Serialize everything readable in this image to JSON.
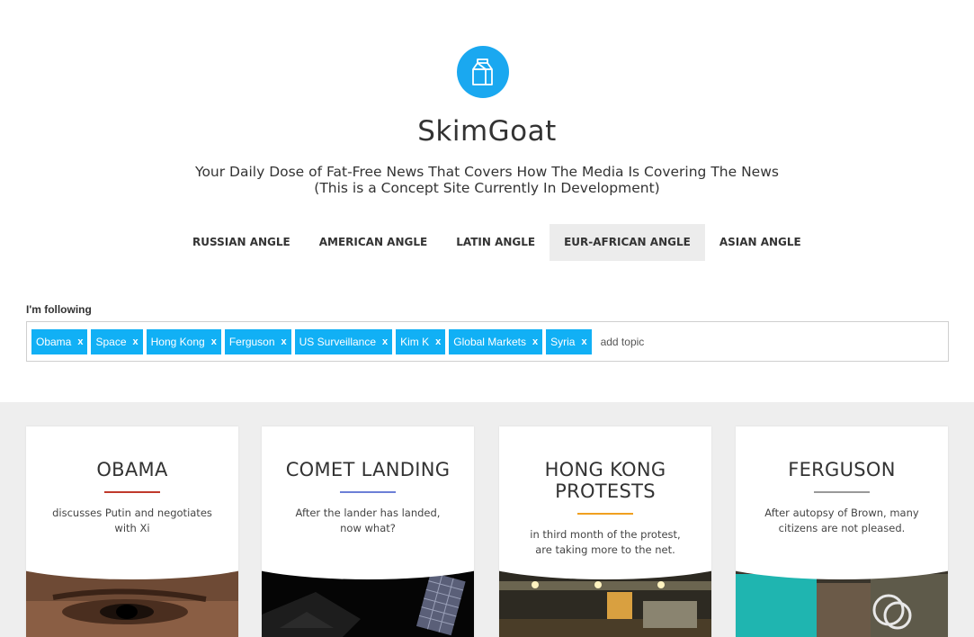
{
  "header": {
    "icon": "milk-carton-icon",
    "title": "SkimGoat",
    "tagline_line1": "Your Daily Dose of Fat-Free News That Covers How The Media Is Covering The News",
    "tagline_line2": "(This is a Concept Site Currently In Development)"
  },
  "nav": {
    "items": [
      {
        "label": "RUSSIAN ANGLE"
      },
      {
        "label": "AMERICAN ANGLE"
      },
      {
        "label": "LATIN ANGLE"
      },
      {
        "label": "EUR-AFRICAN ANGLE"
      },
      {
        "label": "ASIAN ANGLE"
      }
    ],
    "active": "EUR-AFRICAN ANGLE"
  },
  "following": {
    "label": "I'm following",
    "tags": [
      {
        "label": "Obama"
      },
      {
        "label": "Space"
      },
      {
        "label": "Hong Kong"
      },
      {
        "label": "Ferguson"
      },
      {
        "label": "US Surveillance"
      },
      {
        "label": "Kim K"
      },
      {
        "label": "Global Markets"
      },
      {
        "label": "Syria"
      }
    ],
    "remove_glyph": "x",
    "input_placeholder": "add topic"
  },
  "cards": [
    {
      "title": "OBAMA",
      "description": "discusses Putin and negotiates with Xi",
      "accent": "#c0392b"
    },
    {
      "title": "COMET LANDING",
      "description": "After the lander has landed, now what?",
      "accent": "#6c7fd6"
    },
    {
      "title": "HONG KONG PROTESTS",
      "description": "in third month of the protest, are taking more to the net.",
      "accent": "#f0a020"
    },
    {
      "title": "FERGUSON",
      "description": "After autopsy of Brown, many citizens are not pleased.",
      "accent": "#999999"
    }
  ],
  "colors": {
    "brand": "#1aa8f0",
    "tag": "#11b0f5",
    "page_bg": "#eeeeee"
  }
}
